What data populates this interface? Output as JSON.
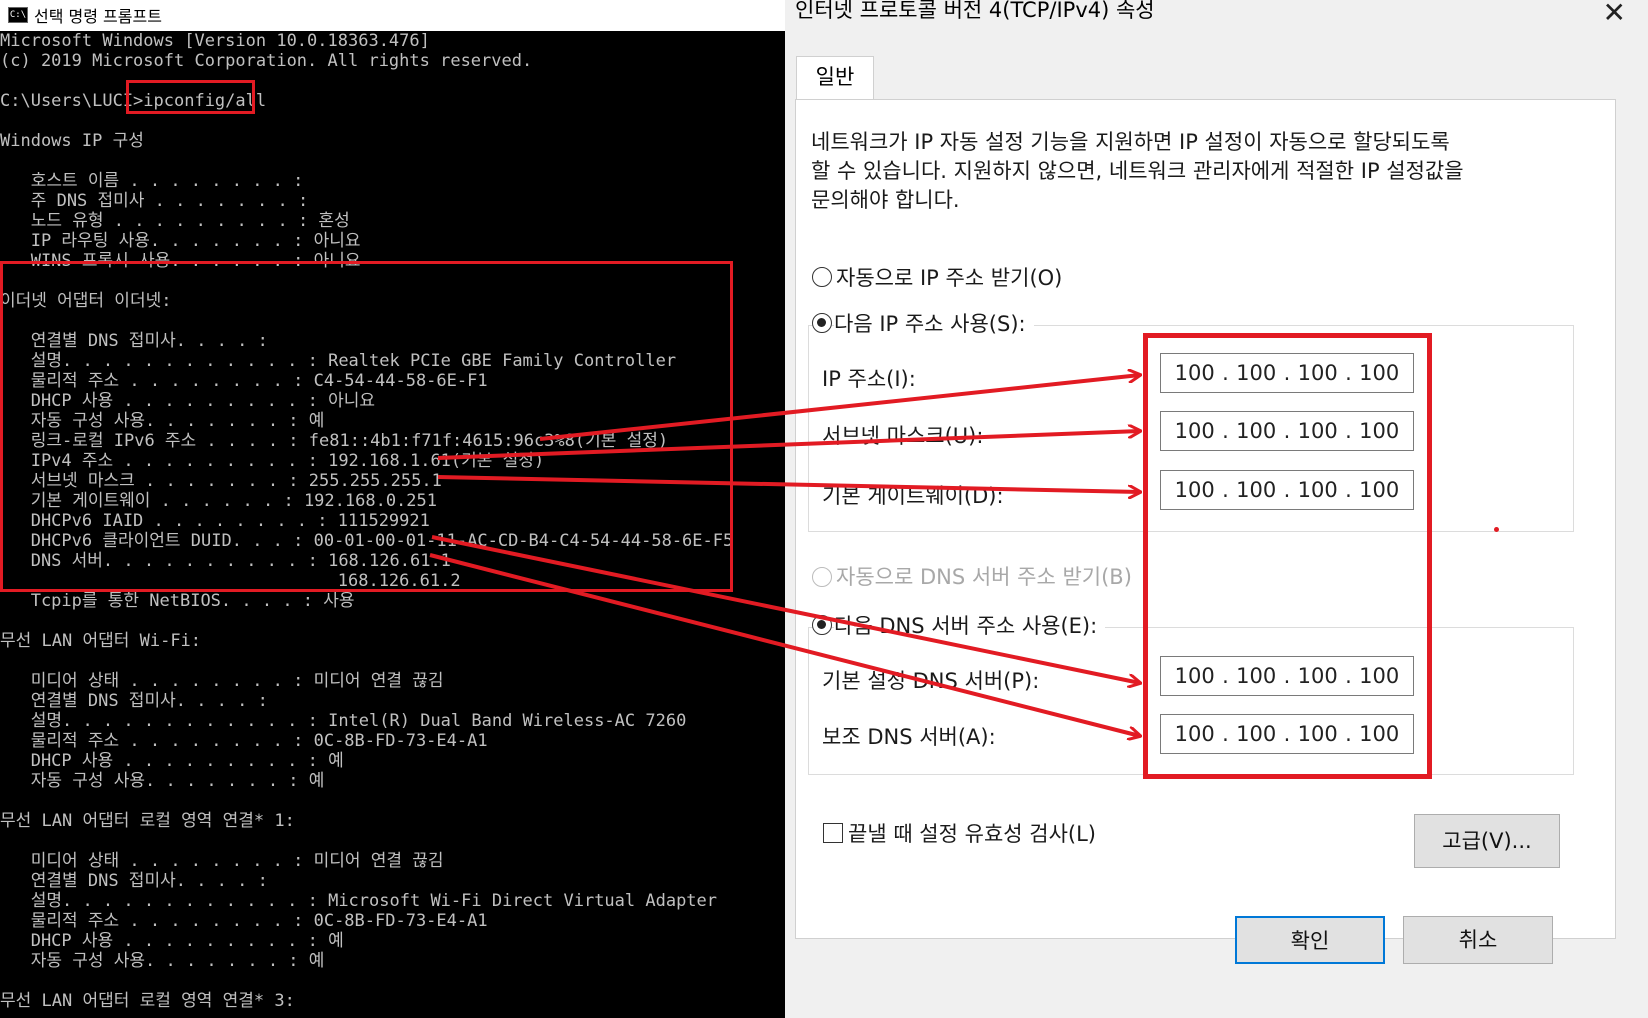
{
  "console": {
    "title": "선택 명령 프롬프트",
    "icon_label": "C:\\",
    "lines": [
      "Microsoft Windows [Version 10.0.18363.476]",
      "(c) 2019 Microsoft Corporation. All rights reserved.",
      "",
      "C:\\Users\\LUCI>ipconfig/all",
      "",
      "Windows IP 구성",
      "",
      "   호스트 이름 . . . . . . . . :",
      "   주 DNS 접미사 . . . . . . . :",
      "   노드 유형 . . . . . . . . . : 혼성",
      "   IP 라우팅 사용. . . . . . . : 아니요",
      "   WINS 프록시 사용. . . . . . : 아니요",
      "",
      "이더넷 어댑터 이더넷:",
      "",
      "   연결별 DNS 접미사. . . . :",
      "   설명. . . . . . . . . . . . : Realtek PCIe GBE Family Controller",
      "   물리적 주소 . . . . . . . . : C4-54-44-58-6E-F1",
      "   DHCP 사용 . . . . . . . . . : 아니요",
      "   자동 구성 사용. . . . . . . : 예",
      "   링크-로컬 IPv6 주소 . . . . : fe81::4b1:f71f:4615:96c3%8(기본 설정)",
      "   IPv4 주소 . . . . . . . . . : 192.168.1.61(기본 설정)",
      "   서브넷 마스크 . . . . . . . : 255.255.255.1",
      "   기본 게이트웨이 . . . . . . : 192.168.0.251",
      "   DHCPv6 IAID . . . . . . . . : 111529921",
      "   DHCPv6 클라이언트 DUID. . . : 00-01-00-01-11-AC-CD-B4-C4-54-44-58-6E-F5",
      "   DNS 서버. . . . . . . . . . : 168.126.61.1",
      "                                 168.126.61.2",
      "   Tcpip를 통한 NetBIOS. . . . : 사용",
      "",
      "무선 LAN 어댑터 Wi-Fi:",
      "",
      "   미디어 상태 . . . . . . . . : 미디어 연결 끊김",
      "   연결별 DNS 접미사. . . . :",
      "   설명. . . . . . . . . . . . : Intel(R) Dual Band Wireless-AC 7260",
      "   물리적 주소 . . . . . . . . : 0C-8B-FD-73-E4-A1",
      "   DHCP 사용 . . . . . . . . . : 예",
      "   자동 구성 사용. . . . . . . : 예",
      "",
      "무선 LAN 어댑터 로컬 영역 연결* 1:",
      "",
      "   미디어 상태 . . . . . . . . : 미디어 연결 끊김",
      "   연결별 DNS 접미사. . . . :",
      "   설명. . . . . . . . . . . . : Microsoft Wi-Fi Direct Virtual Adapter",
      "   물리적 주소 . . . . . . . . : 0C-8B-FD-73-E4-A1",
      "   DHCP 사용 . . . . . . . . . : 예",
      "   자동 구성 사용. . . . . . . : 예",
      "",
      "무선 LAN 어댑터 로컬 영역 연결* 3:"
    ]
  },
  "dialog": {
    "title": "인터넷 프로토콜 버전 4(TCP/IPv4) 속성",
    "close_icon": "close-icon",
    "tab_general": "일반",
    "description": [
      "네트워크가 IP 자동 설정 기능을 지원하면 IP 설정이 자동으로 할당되도록",
      "할 수 있습니다. 지원하지 않으면, 네트워크 관리자에게 적절한 IP 설정값을",
      "문의해야 합니다."
    ],
    "radio_auto_ip": "자동으로 IP 주소 받기(O)",
    "radio_manual_ip": "다음 IP 주소 사용(S):",
    "label_ip": "IP 주소(I):",
    "label_subnet": "서브넷 마스크(U):",
    "label_gateway": "기본 게이트웨이(D):",
    "radio_auto_dns": "자동으로 DNS 서버 주소 받기(B)",
    "radio_manual_dns": "다음 DNS 서버 주소 사용(E):",
    "label_dns1": "기본 설정 DNS 서버(P):",
    "label_dns2": "보조 DNS 서버(A):",
    "ip_value": [
      "100",
      "100",
      "100",
      "100"
    ],
    "subnet_value": [
      "100",
      "100",
      "100",
      "100"
    ],
    "gateway_value": [
      "100",
      "100",
      "100",
      "100"
    ],
    "dns1_value": [
      "100",
      "100",
      "100",
      "100"
    ],
    "dns2_value": [
      "100",
      "100",
      "100",
      "100"
    ],
    "checkbox_validate": "끝낼 때 설정 유효성 검사(L)",
    "advanced_button": "고급(V)...",
    "ok_button": "확인",
    "cancel_button": "취소"
  },
  "colors": {
    "highlight": "#e21b23",
    "console_bg": "#000000",
    "console_text": "#c0c0c0",
    "dialog_bg": "#f0f0f0",
    "primary_border": "#0078d7"
  }
}
